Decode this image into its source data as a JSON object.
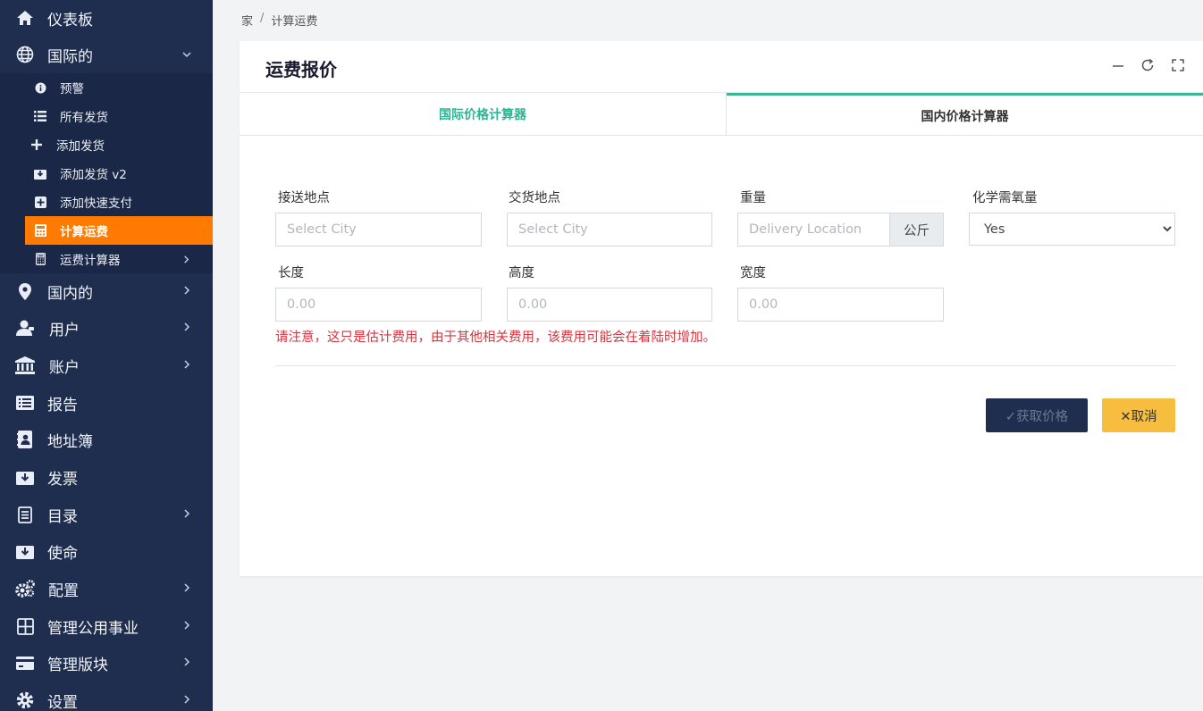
{
  "sidebar": {
    "items": [
      {
        "label": "仪表板",
        "icon": "home-icon"
      },
      {
        "label": "国际的",
        "icon": "globe-icon",
        "expanded": true
      },
      {
        "label": "国内的",
        "icon": "map-marker-icon"
      },
      {
        "label": "用户",
        "icon": "user-icon"
      },
      {
        "label": "账户",
        "icon": "bank-icon"
      },
      {
        "label": "报告",
        "icon": "list-alt-icon"
      },
      {
        "label": "地址簿",
        "icon": "address-book-icon"
      },
      {
        "label": "发票",
        "icon": "inbox-download-icon"
      },
      {
        "label": "目录",
        "icon": "file-text-icon"
      },
      {
        "label": "使命",
        "icon": "inbox-download-icon"
      },
      {
        "label": "配置",
        "icon": "cogs-icon"
      },
      {
        "label": "管理公用事业",
        "icon": "grid-icon"
      },
      {
        "label": "管理版块",
        "icon": "credit-card-icon"
      },
      {
        "label": "设置",
        "icon": "gear-icon"
      }
    ],
    "sub_items": [
      {
        "label": "预警",
        "icon": "info-circle-icon"
      },
      {
        "label": "所有发货",
        "icon": "list-icon"
      },
      {
        "label": "添加发货",
        "icon": "plus-icon"
      },
      {
        "label": "添加发货 v2",
        "icon": "inbox-download-icon"
      },
      {
        "label": "添加快速支付",
        "icon": "plus-square-icon"
      },
      {
        "label": "计算运费",
        "icon": "calculator-icon",
        "active": true
      },
      {
        "label": "运费计算器",
        "icon": "calculator-outline-icon"
      }
    ]
  },
  "breadcrumb": {
    "home": "家",
    "separator": "/",
    "current": "计算运费"
  },
  "card": {
    "title": "运费报价",
    "tabs": [
      {
        "label": "国际价格计算器"
      },
      {
        "label": "国内价格计算器"
      }
    ]
  },
  "form": {
    "pickup": {
      "label": "接送地点",
      "placeholder": "Select City"
    },
    "delivery": {
      "label": "交货地点",
      "placeholder": "Select City"
    },
    "weight": {
      "label": "重量",
      "placeholder": "Delivery Location",
      "unit": "公斤"
    },
    "cod": {
      "label": "化学需氧量",
      "value": "Yes"
    },
    "length": {
      "label": "长度",
      "placeholder": "0.00"
    },
    "height": {
      "label": "高度",
      "placeholder": "0.00"
    },
    "width": {
      "label": "宽度",
      "placeholder": "0.00"
    },
    "note": "请注意，这只是估计费用，由于其他相关费用，该费用可能会在着陆时增加。",
    "submit_label": "✓获取价格",
    "cancel_label": "✕取消"
  },
  "colors": {
    "sidebar": "#1f2d4e",
    "active": "#ff7a00",
    "accent": "#2bb592",
    "danger": "#d9343f",
    "warning": "#f7bd3e"
  }
}
